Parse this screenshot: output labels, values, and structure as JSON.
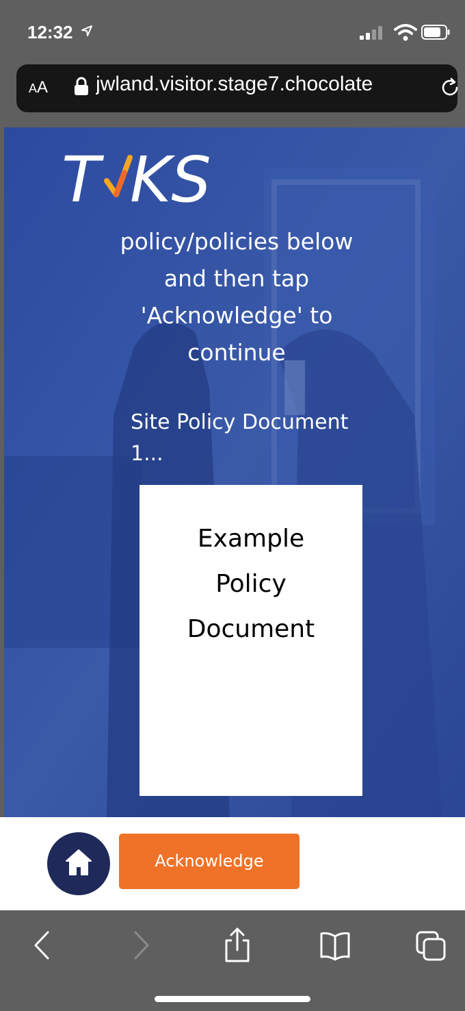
{
  "status_bar": {
    "time": "12:32"
  },
  "address_bar": {
    "text_size_label_small": "A",
    "text_size_label_large": "A",
    "url": "jwland.visitor.stage7.chocolate"
  },
  "hero": {
    "logo_text": "TIKS",
    "instruction": "policy/policies below and then tap 'Acknowledge' to continue",
    "document_title": "Site Policy Document 1...",
    "document_preview": [
      "Example",
      "Policy",
      "Document"
    ]
  },
  "footer": {
    "acknowledge_label": "Acknowledge"
  },
  "colors": {
    "hero_blue": "#2b4a9a",
    "accent_orange": "#ef7228",
    "home_button_navy": "#1f2a5a",
    "browser_gray": "#5f5f5f"
  }
}
